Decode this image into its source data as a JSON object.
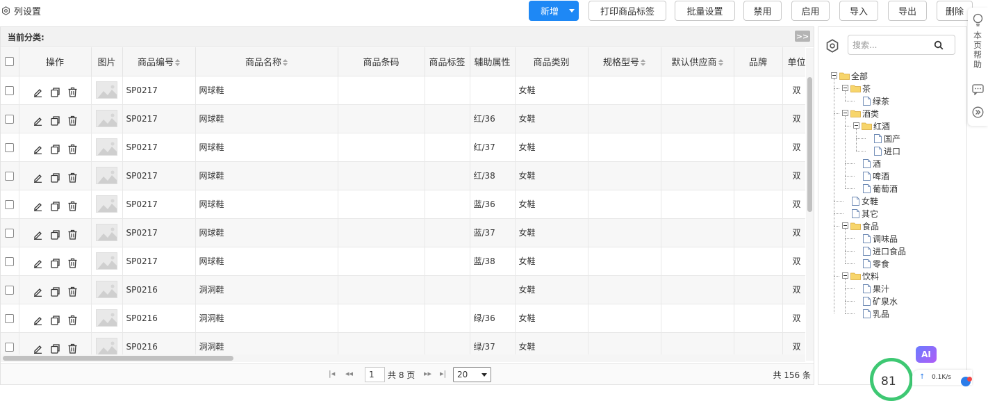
{
  "toolbar": {
    "column_settings": "列设置",
    "new": "新增",
    "print_labels": "打印商品标签",
    "batch_settings": "批量设置",
    "disable": "禁用",
    "enable": "启用",
    "import": "导入",
    "export": "导出",
    "delete": "删除"
  },
  "category_bar": {
    "label": "当前分类:",
    "expand": ">>"
  },
  "table": {
    "headers": [
      "操作",
      "图片",
      "商品编号",
      "商品名称",
      "商品条码",
      "商品标签",
      "辅助属性",
      "商品类别",
      "规格型号",
      "默认供应商",
      "品牌",
      "单位"
    ],
    "rows": [
      {
        "code": "SP0217",
        "name": "网球鞋",
        "barcode": "",
        "tag": "",
        "attr": "",
        "category": "女鞋",
        "spec": "",
        "supplier": "",
        "brand": "",
        "unit": "双"
      },
      {
        "code": "SP0217",
        "name": "网球鞋",
        "barcode": "",
        "tag": "",
        "attr": "红/36",
        "category": "女鞋",
        "spec": "",
        "supplier": "",
        "brand": "",
        "unit": "双"
      },
      {
        "code": "SP0217",
        "name": "网球鞋",
        "barcode": "",
        "tag": "",
        "attr": "红/37",
        "category": "女鞋",
        "spec": "",
        "supplier": "",
        "brand": "",
        "unit": "双"
      },
      {
        "code": "SP0217",
        "name": "网球鞋",
        "barcode": "",
        "tag": "",
        "attr": "红/38",
        "category": "女鞋",
        "spec": "",
        "supplier": "",
        "brand": "",
        "unit": "双"
      },
      {
        "code": "SP0217",
        "name": "网球鞋",
        "barcode": "",
        "tag": "",
        "attr": "蓝/36",
        "category": "女鞋",
        "spec": "",
        "supplier": "",
        "brand": "",
        "unit": "双"
      },
      {
        "code": "SP0217",
        "name": "网球鞋",
        "barcode": "",
        "tag": "",
        "attr": "蓝/37",
        "category": "女鞋",
        "spec": "",
        "supplier": "",
        "brand": "",
        "unit": "双"
      },
      {
        "code": "SP0217",
        "name": "网球鞋",
        "barcode": "",
        "tag": "",
        "attr": "蓝/38",
        "category": "女鞋",
        "spec": "",
        "supplier": "",
        "brand": "",
        "unit": "双"
      },
      {
        "code": "SP0216",
        "name": "洞洞鞋",
        "barcode": "",
        "tag": "",
        "attr": "",
        "category": "女鞋",
        "spec": "",
        "supplier": "",
        "brand": "",
        "unit": "双"
      },
      {
        "code": "SP0216",
        "name": "洞洞鞋",
        "barcode": "",
        "tag": "",
        "attr": "绿/36",
        "category": "女鞋",
        "spec": "",
        "supplier": "",
        "brand": "",
        "unit": "双"
      },
      {
        "code": "SP0216",
        "name": "洞洞鞋",
        "barcode": "",
        "tag": "",
        "attr": "绿/37",
        "category": "女鞋",
        "spec": "",
        "supplier": "",
        "brand": "",
        "unit": "双"
      }
    ]
  },
  "pager": {
    "current_page": "1",
    "total_pages": "共 8 页",
    "page_size": "20",
    "total_records": "共 156 条"
  },
  "tree": {
    "search_placeholder": "搜索...",
    "nodes": [
      "全部",
      "茶",
      "绿茶",
      "酒类",
      "红酒",
      "国产",
      "进口",
      "酒",
      "啤酒",
      "葡萄酒",
      "女鞋",
      "其它",
      "食品",
      "调味品",
      "进口食品",
      "零食",
      "饮料",
      "果汁",
      "矿泉水",
      "乳品"
    ]
  },
  "side_strip": {
    "help": "本页帮助"
  },
  "widgets": {
    "ai": "AI",
    "gauge_value": "81",
    "net_speed": "0.1K/s"
  },
  "colors": {
    "primary": "#1e88f5",
    "folder": "#f7d56b",
    "gauge": "#3ec873"
  }
}
